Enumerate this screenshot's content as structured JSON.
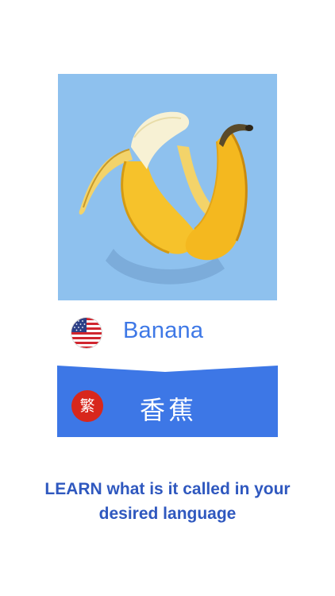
{
  "card": {
    "image": "banana-photo",
    "background_color": "#8ec1ee",
    "source": {
      "flag": "us-flag-icon",
      "word": "Banana"
    },
    "target": {
      "badge": "繁",
      "badge_color": "#d8271c",
      "word": "香蕉",
      "banner_color": "#3d77e6"
    }
  },
  "tagline": {
    "line1": "LEARN what is it called in your",
    "line2": "desired language"
  }
}
